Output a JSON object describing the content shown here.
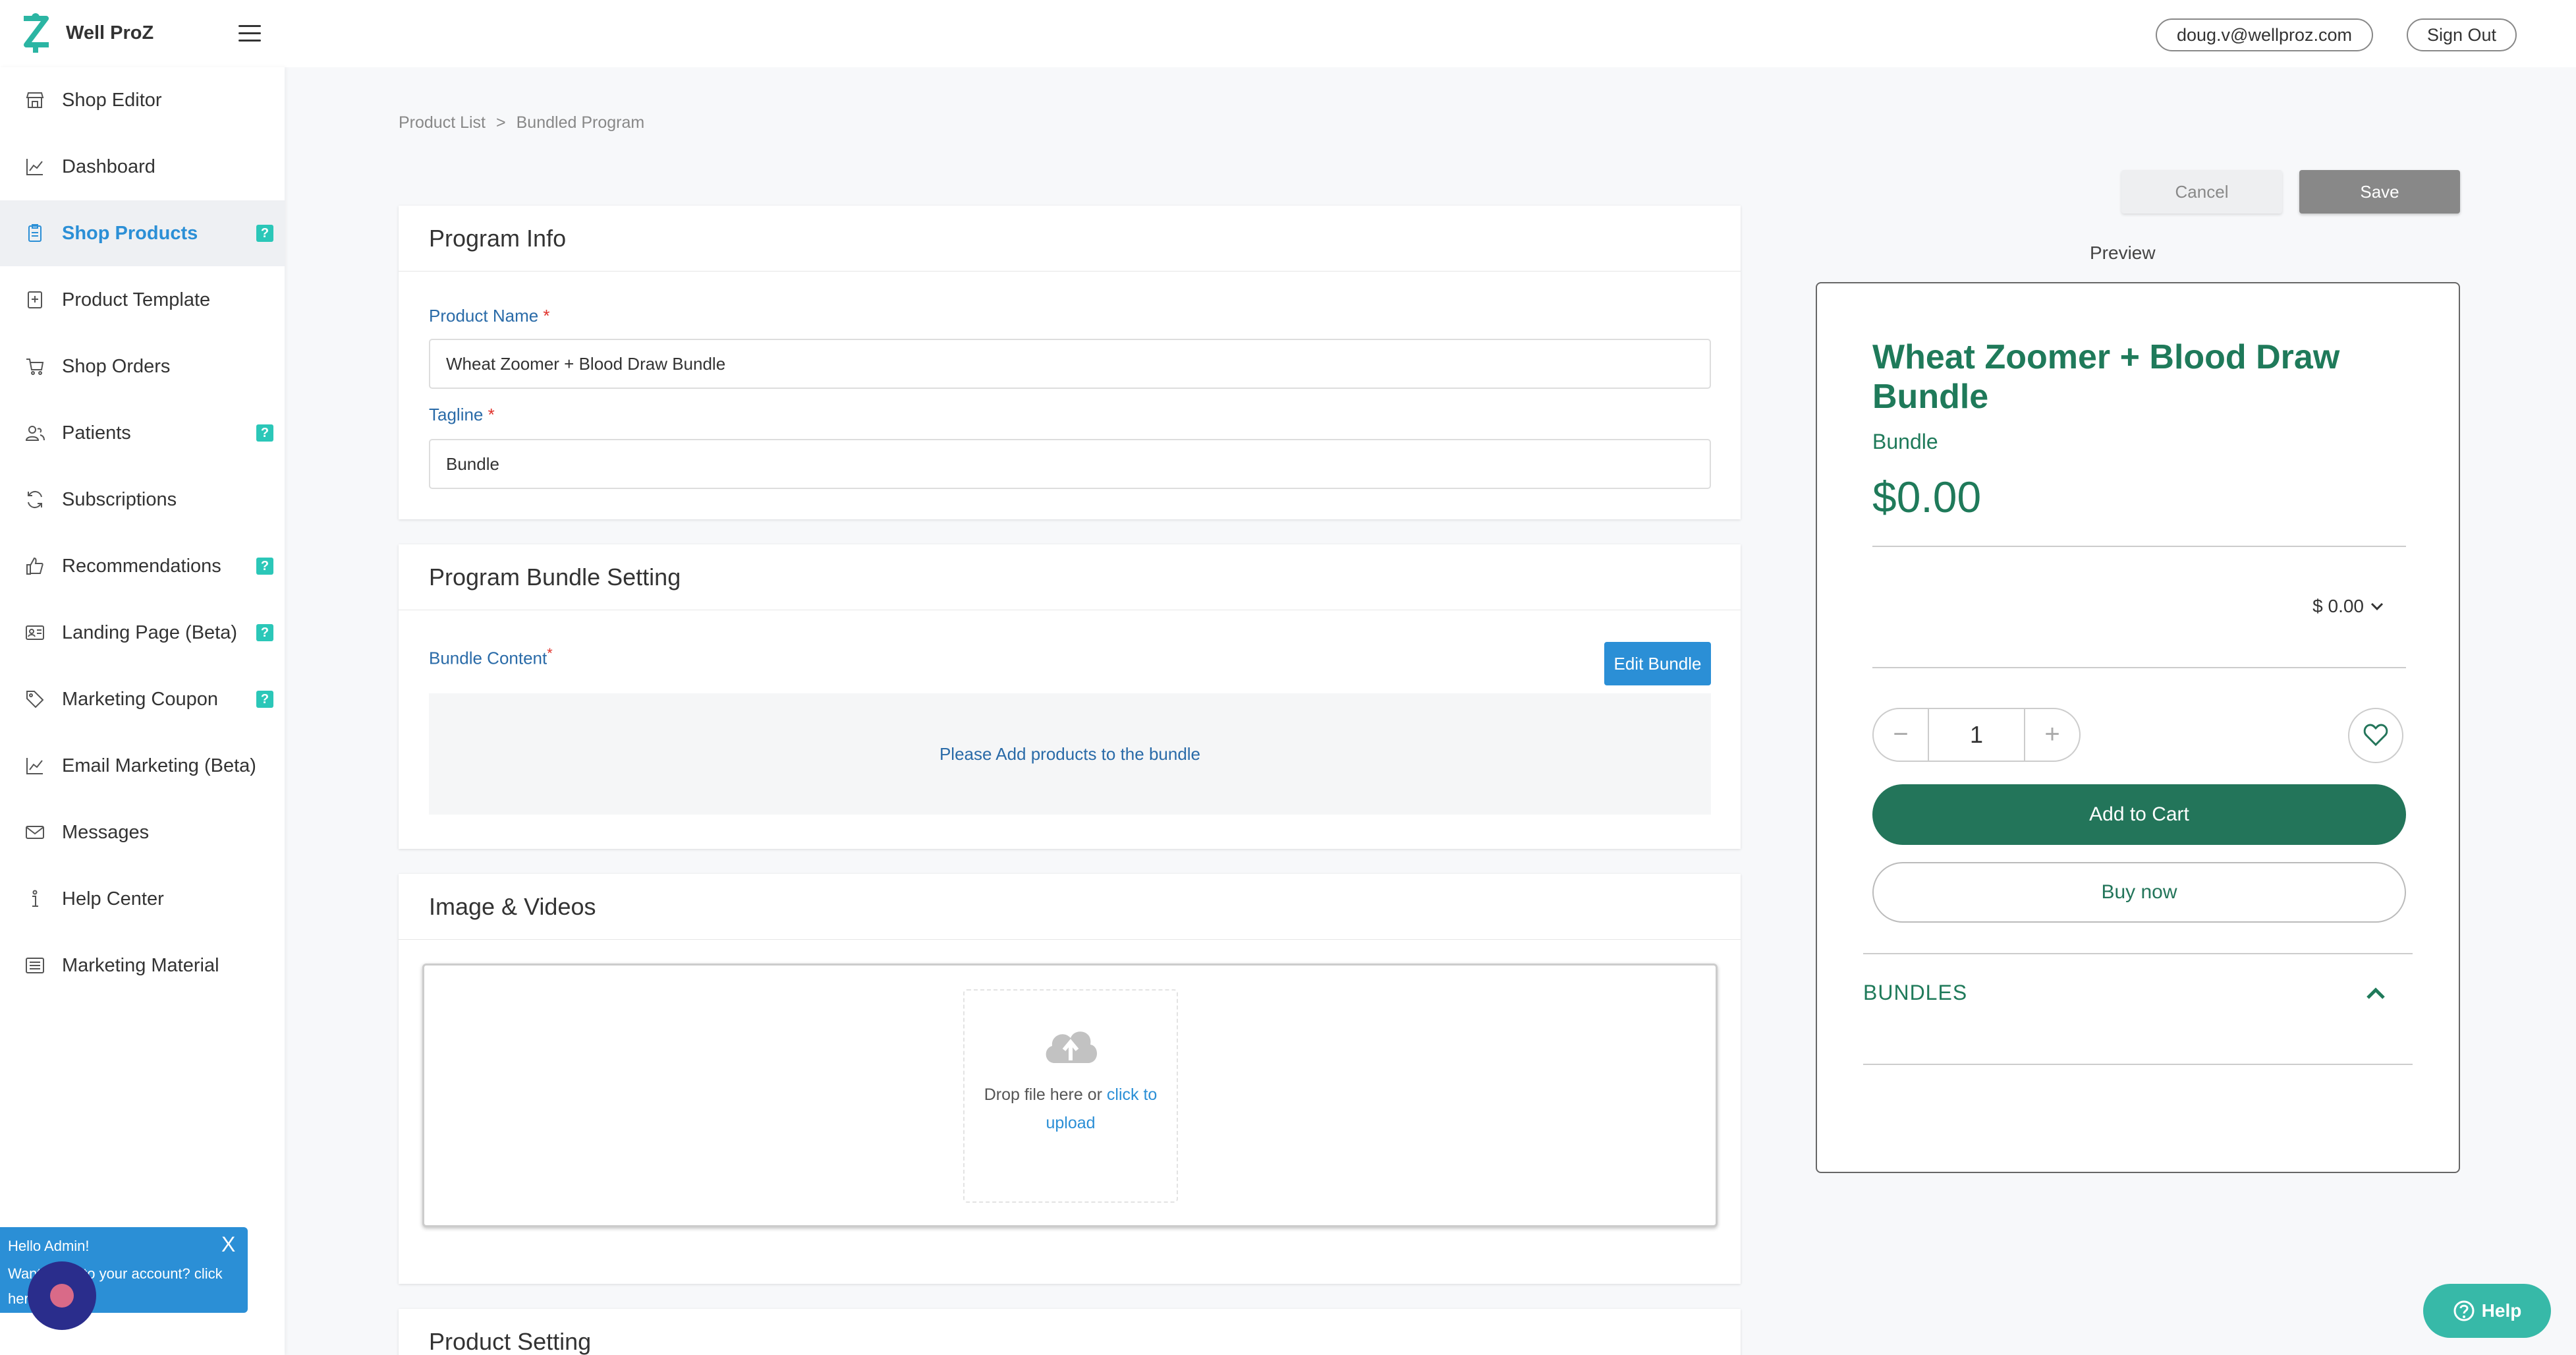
{
  "app": {
    "name": "Well ProZ",
    "user_email": "doug.v@wellproz.com",
    "sign_out_label": "Sign Out"
  },
  "sidebar": {
    "items": [
      {
        "label": "Shop Editor",
        "icon": "shop-icon",
        "help": false,
        "active": false
      },
      {
        "label": "Dashboard",
        "icon": "chart-line-icon",
        "help": false,
        "active": false
      },
      {
        "label": "Shop Products",
        "icon": "clipboard-icon",
        "help": true,
        "active": true
      },
      {
        "label": "Product Template",
        "icon": "template-icon",
        "help": false,
        "active": false
      },
      {
        "label": "Shop Orders",
        "icon": "cart-icon",
        "help": false,
        "active": false
      },
      {
        "label": "Patients",
        "icon": "users-icon",
        "help": true,
        "active": false
      },
      {
        "label": "Subscriptions",
        "icon": "refresh-icon",
        "help": false,
        "active": false
      },
      {
        "label": "Recommendations",
        "icon": "thumbs-up-icon",
        "help": true,
        "active": false
      },
      {
        "label": "Landing Page (Beta)",
        "icon": "id-card-icon",
        "help": true,
        "active": false
      },
      {
        "label": "Marketing Coupon",
        "icon": "tag-icon",
        "help": true,
        "active": false
      },
      {
        "label": "Email Marketing (Beta)",
        "icon": "chart-line-icon",
        "help": false,
        "active": false
      },
      {
        "label": "Messages",
        "icon": "mail-icon",
        "help": false,
        "active": false
      },
      {
        "label": "Help Center",
        "icon": "info-icon",
        "help": false,
        "active": false
      },
      {
        "label": "Marketing Material",
        "icon": "list-icon",
        "help": false,
        "active": false
      }
    ],
    "help_badge": "?"
  },
  "breadcrumb": {
    "items": [
      "Product List",
      "Bundled Program"
    ],
    "separator": ">"
  },
  "actions": {
    "cancel_label": "Cancel",
    "save_label": "Save"
  },
  "program_info": {
    "title": "Program Info",
    "product_name_label": "Product Name",
    "product_name_value": "Wheat Zoomer + Blood Draw Bundle",
    "tagline_label": "Tagline",
    "tagline_value": "Bundle",
    "required_mark": "*"
  },
  "bundle_setting": {
    "title": "Program Bundle Setting",
    "content_label": "Bundle Content",
    "edit_label": "Edit Bundle",
    "empty_text": "Please Add products to the bundle"
  },
  "media": {
    "title": "Image & Videos",
    "drop_text": "Drop file here or ",
    "click_text": "click to upload"
  },
  "product_setting": {
    "title": "Product Setting"
  },
  "preview": {
    "label": "Preview",
    "title": "Wheat Zoomer + Blood Draw Bundle",
    "tagline": "Bundle",
    "price": "$0.00",
    "select_value": "$ 0.00",
    "quantity": "1",
    "add_to_cart": "Add to Cart",
    "buy_now": "Buy now",
    "bundles_label": "BUNDLES"
  },
  "chat": {
    "greeting": "Hello Admin!",
    "message": "Want quick to your account? click here",
    "close": "X"
  },
  "help_button": "Help",
  "colors": {
    "brand_green": "#1f7a5a",
    "accent_blue": "#2b8fd6",
    "help_teal": "#37b9a8",
    "badge_teal": "#2bc7b8"
  }
}
